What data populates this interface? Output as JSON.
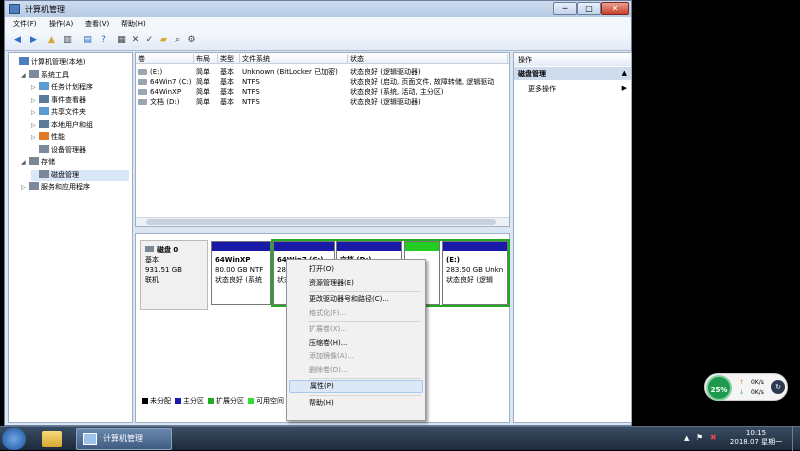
{
  "window": {
    "title": "计算机管理",
    "buttons": {
      "minimize": "─",
      "maximize": "□",
      "close": "✕"
    }
  },
  "menu": [
    "文件(F)",
    "操作(A)",
    "查看(V)",
    "帮助(H)"
  ],
  "tree": [
    {
      "label": "计算机管理(本地)",
      "level": 0,
      "expand": ""
    },
    {
      "label": "系统工具",
      "level": 1,
      "expand": "◢"
    },
    {
      "label": "任务计划程序",
      "level": 2,
      "expand": "▷"
    },
    {
      "label": "事件查看器",
      "level": 2,
      "expand": "▷"
    },
    {
      "label": "共享文件夹",
      "level": 2,
      "expand": "▷"
    },
    {
      "label": "本地用户和组",
      "level": 2,
      "expand": "▷"
    },
    {
      "label": "性能",
      "level": 2,
      "expand": "▷"
    },
    {
      "label": "设备管理器",
      "level": 2,
      "expand": ""
    },
    {
      "label": "存储",
      "level": 1,
      "expand": "◢"
    },
    {
      "label": "磁盘管理",
      "level": 2,
      "expand": "",
      "selected": true
    },
    {
      "label": "服务和应用程序",
      "level": 1,
      "expand": "▷"
    }
  ],
  "volume_table": {
    "headers": [
      "卷",
      "布局",
      "类型",
      "文件系统",
      "状态"
    ],
    "rows": [
      [
        "(E:)",
        "简单",
        "基本",
        "Unknown (BitLocker 已加密)",
        "状态良好 (逻辑驱动器)"
      ],
      [
        "64Win7 (C:)",
        "简单",
        "基本",
        "NTFS",
        "状态良好 (启动, 页面文件, 故障转储, 逻辑驱动"
      ],
      [
        "64WinXP",
        "简单",
        "基本",
        "NTFS",
        "状态良好 (系统, 活动, 主分区)"
      ],
      [
        "文档 (D:)",
        "简单",
        "基本",
        "NTFS",
        "状态良好 (逻辑驱动器)"
      ]
    ]
  },
  "disk": {
    "name": "磁盘 0",
    "type": "基本",
    "size": "931.51 GB",
    "status": "联机",
    "partitions": [
      {
        "name": "64WinXP",
        "size": "80.00 GB NTF",
        "status": "状态良好 (系统",
        "color": "#1a1aa8"
      },
      {
        "name": "64Win7 (C:)",
        "size": "284",
        "status": "状态",
        "color": "#1a1aa8"
      },
      {
        "name": "文档 (D:)",
        "size": "",
        "status": "",
        "color": "#1a1aa8"
      },
      {
        "name": "",
        "size": "",
        "status": "",
        "color": "#22cc22"
      },
      {
        "name": "(E:)",
        "size": "283.50 GB Unkn",
        "status": "状态良好 (逻辑",
        "color": "#1a1aa8"
      }
    ]
  },
  "legend": [
    {
      "label": "未分配",
      "color": "#000000"
    },
    {
      "label": "主分区",
      "color": "#1a1aa8"
    },
    {
      "label": "扩展分区",
      "color": "#22aa22"
    },
    {
      "label": "可用空间",
      "color": "#33dd33"
    }
  ],
  "ops": {
    "title": "操作",
    "selected": "磁盘管理",
    "more": "更多操作"
  },
  "context_menu": [
    {
      "label": "打开(O)",
      "disabled": false
    },
    {
      "label": "资源管理器(E)",
      "disabled": false
    },
    {
      "sep": true
    },
    {
      "label": "更改驱动器号和路径(C)...",
      "disabled": false
    },
    {
      "label": "格式化(F)...",
      "disabled": true
    },
    {
      "sep": true
    },
    {
      "label": "扩展卷(X)...",
      "disabled": true
    },
    {
      "label": "压缩卷(H)...",
      "disabled": false
    },
    {
      "label": "添加镜像(A)...",
      "disabled": true
    },
    {
      "label": "删除卷(D)...",
      "disabled": true
    },
    {
      "sep": true
    },
    {
      "label": "属性(P)",
      "disabled": false,
      "highlighted": true
    },
    {
      "sep": true
    },
    {
      "label": "帮助(H)",
      "disabled": false
    }
  ],
  "taskbar": {
    "app_label": "计算机管理",
    "time": "10:15",
    "date": "2018.07 星期一"
  },
  "widget": {
    "percent": "25%",
    "up": "0K/s",
    "down": "0K/s"
  }
}
